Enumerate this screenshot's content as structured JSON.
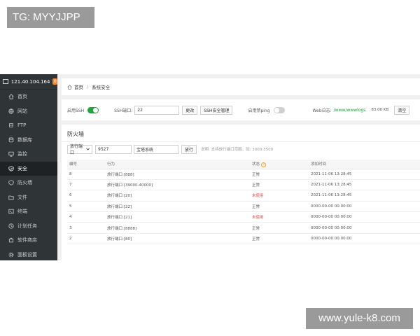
{
  "watermark_top": "TG: MYYJJPP",
  "watermark_bottom": "www.yule-k8.com",
  "server": {
    "ip": "121.40.104.164",
    "badge": "0"
  },
  "sidebar": {
    "items": [
      {
        "label": "首页",
        "icon": "home-icon"
      },
      {
        "label": "网站",
        "icon": "globe-icon"
      },
      {
        "label": "FTP",
        "icon": "ftp-icon"
      },
      {
        "label": "数据库",
        "icon": "database-icon"
      },
      {
        "label": "监控",
        "icon": "monitor-icon"
      },
      {
        "label": "安全",
        "icon": "shield-icon",
        "active": true
      },
      {
        "label": "防火墙",
        "icon": "firewall-icon"
      },
      {
        "label": "文件",
        "icon": "folder-icon"
      },
      {
        "label": "终端",
        "icon": "terminal-icon"
      },
      {
        "label": "计划任务",
        "icon": "clock-icon"
      },
      {
        "label": "软件商店",
        "icon": "store-icon"
      },
      {
        "label": "面板设置",
        "icon": "gear-icon"
      }
    ]
  },
  "breadcrumb": {
    "home": "首页",
    "current": "系统安全"
  },
  "config": {
    "ssh_label": "启用SSH",
    "ssh_enabled": true,
    "port_label": "SSH端口:",
    "port_value": "22",
    "change_btn": "更改",
    "ssh_manage_btn": "SSH安全管理",
    "ping_label": "启用禁ping",
    "ping_enabled": false,
    "weblog_label": "Web日志:",
    "weblog_path": "/www/wwwlogs",
    "weblog_size": "83.00 KB",
    "clear_btn": "清空"
  },
  "firewall": {
    "title": "防火墙",
    "action_select": "放行端口",
    "port_input": "9527",
    "remark_input": "宝塔系统",
    "allow_btn": "放行",
    "hint": "说明: 支持放行端口范围，如: 3000:3500",
    "columns": [
      "编号",
      "行为",
      "状态",
      "添加时间"
    ],
    "rows": [
      {
        "id": "8",
        "action": "放行端口:[888]",
        "status": "正常",
        "time": "2021-11-06 13:28:45"
      },
      {
        "id": "7",
        "action": "放行端口:[39000-40000]",
        "status": "正常",
        "time": "2021-11-06 13:28:45"
      },
      {
        "id": "6",
        "action": "放行端口:[20]",
        "status": "未使用",
        "time": "2021-11-06 13:28:45"
      },
      {
        "id": "5",
        "action": "放行端口:[22]",
        "status": "正常",
        "time": "0000-00-00 00:00:00"
      },
      {
        "id": "4",
        "action": "放行端口:[21]",
        "status": "未使用",
        "time": "0000-00-00 00:00:00"
      },
      {
        "id": "3",
        "action": "放行端口:[8888]",
        "status": "正常",
        "time": "0000-00-00 00:00:00"
      },
      {
        "id": "2",
        "action": "放行端口:[80]",
        "status": "正常",
        "time": "0000-00-00 00:00:00"
      }
    ]
  },
  "colors": {
    "sidebar_bg": "#2f3437",
    "accent_green": "#20a53a",
    "badge_orange": "#f0883a",
    "status_red": "#e05050"
  }
}
